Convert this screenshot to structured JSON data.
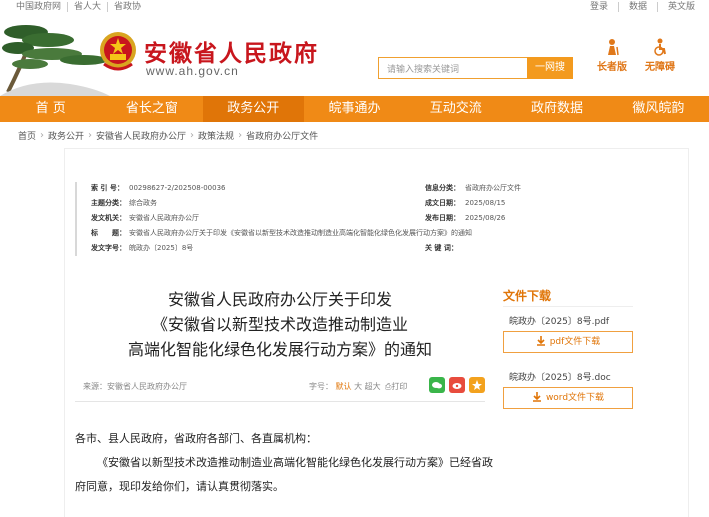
{
  "topbar": {
    "links": [
      "中国政府网",
      "省人大",
      "省政协"
    ],
    "right_links": [
      "登录",
      "数据",
      "英文版"
    ]
  },
  "header": {
    "site_name": "安徽省人民政府",
    "site_url": "www.ah.gov.cn",
    "search_placeholder": "请输入搜索关键词",
    "search_button": "一网搜",
    "tool_elder": "长者版",
    "tool_access": "无障碍"
  },
  "nav": {
    "items": [
      "首 页",
      "省长之窗",
      "政务公开",
      "皖事通办",
      "互动交流",
      "政府数据",
      "徽风皖韵"
    ],
    "active_index": 2
  },
  "breadcrumb": [
    "首页",
    "政务公开",
    "安徽省人民政府办公厅",
    "政策法规",
    "省政府办公厅文件"
  ],
  "meta": {
    "index_label": "索 引 号：",
    "index_value": "00298627-2/202508-00036",
    "info_source_label": "信息分类：",
    "info_source_value": "省政府办公厅文件",
    "topic_label": "主题分类：",
    "topic_value": "综合政务",
    "made_date_label": "成文日期：",
    "made_date_value": "2025/08/15",
    "issuer_label": "发文机关：",
    "issuer_value": "安徽省人民政府办公厅",
    "pub_date_label": "发布日期：",
    "pub_date_value": "2025/08/26",
    "title_label": "标　　题：",
    "title_value": "安徽省人民政府办公厅关于印发《安徽省以新型技术改造推动制造业高端化智能化绿色化发展行动方案》的通知",
    "doc_no_label": "发文字号：",
    "doc_no_value": "皖政办〔2025〕8号",
    "keywords_label": "关 键 词：",
    "keywords_value": ""
  },
  "document": {
    "title_line1": "安徽省人民政府办公厅关于印发",
    "title_line2": "《安徽省以新型技术改造推动制造业",
    "title_line3": "高端化智能化绿色化发展行动方案》的通知",
    "source_label": "来源：",
    "source_value": "安徽省人民政府办公厅",
    "font_size_label": "字号：",
    "font_default": "默认",
    "font_large": "大",
    "font_xlarge": "超大",
    "print_label": "打印",
    "salutation": "各市、县人民政府，省政府各部门、各直属机构：",
    "paragraph1": "《安徽省以新型技术改造推动制造业高端化智能化绿色化发展行动方案》已经省政府同意，现印发给你们，请认真贯彻落实。"
  },
  "downloads": {
    "title": "文件下载",
    "pdf_file": "皖政办〔2025〕8号.pdf",
    "pdf_button": "pdf文件下载",
    "doc_file": "皖政办〔2025〕8号.doc",
    "doc_button": "word文件下载"
  },
  "colors": {
    "brand_red": "#c8161d",
    "nav_orange": "#f08a16",
    "accent_orange": "#e07508"
  }
}
